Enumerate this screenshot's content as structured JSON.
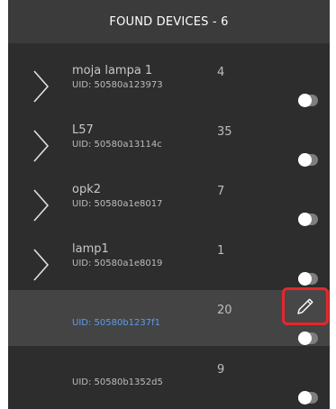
{
  "header": {
    "title": "FOUND DEVICES - 6"
  },
  "devices": [
    {
      "name": "moja lampa 1",
      "uid": "UID: 50580a123973",
      "count": "4"
    },
    {
      "name": "L57",
      "uid": "UID: 50580a13114c",
      "count": "35"
    },
    {
      "name": "opk2",
      "uid": "UID: 50580a1e8017",
      "count": "7"
    },
    {
      "name": "lamp1",
      "uid": "UID: 50580a1e8019",
      "count": "1"
    },
    {
      "name": "",
      "uid": "UID: 50580b1237f1",
      "count": "20"
    },
    {
      "name": "",
      "uid": "UID: 50580b1352d5",
      "count": "9"
    }
  ],
  "icons": {
    "expand": "chevron-right-icon",
    "edit": "pencil-icon",
    "toggle": "toggle-switch"
  },
  "colors": {
    "panel_bg": "#2d2d2d",
    "header_bg": "#3b3b3b",
    "selected_bg": "#444444",
    "selected_uid": "#5a9cf0",
    "edit_highlight": "#e8262b"
  }
}
